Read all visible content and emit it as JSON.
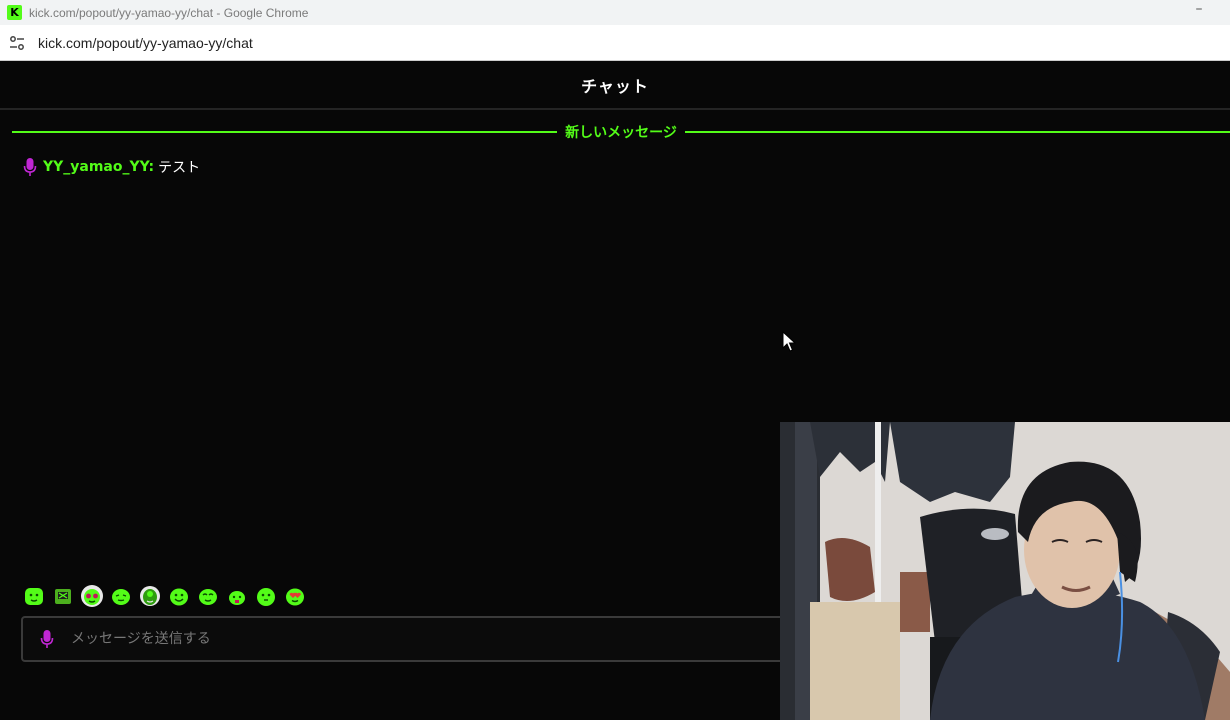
{
  "window": {
    "title": "kick.com/popout/yy-yamao-yy/chat - Google Chrome",
    "favicon_letter": "K",
    "url": "kick.com/popout/yy-yamao-yy/chat"
  },
  "chat": {
    "header": "チャット",
    "new_messages_divider": "新しいメッセージ",
    "messages": [
      {
        "username": "YY_yamao_YY:",
        "text": "テスト",
        "badge": "microphone-icon"
      }
    ],
    "input": {
      "placeholder": "メッセージを送信する",
      "value": ""
    },
    "emotes": [
      "emote-1",
      "emote-2",
      "emote-3",
      "emote-4",
      "emote-5",
      "emote-6",
      "emote-7",
      "emote-8",
      "emote-9",
      "emote-10"
    ]
  },
  "colors": {
    "accent": "#53fc18",
    "badge": "#c026d3",
    "background": "#070707",
    "text": "#ffffff"
  }
}
